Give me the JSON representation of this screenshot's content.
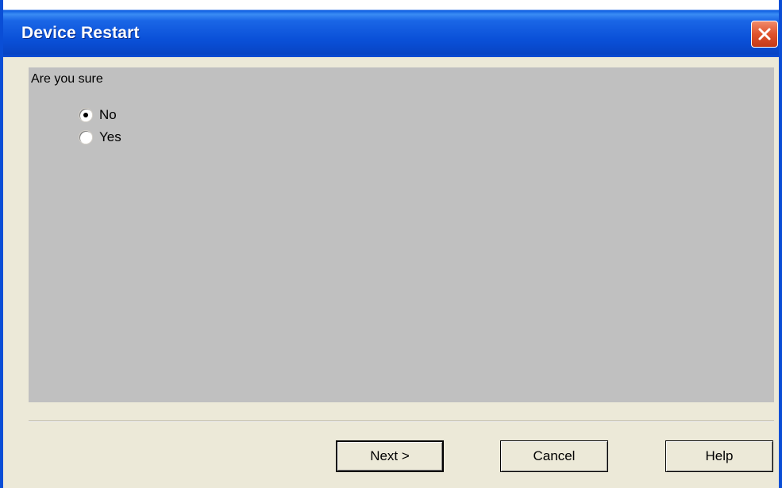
{
  "window": {
    "title": "Device Restart"
  },
  "content": {
    "question": "Are you sure",
    "options": [
      {
        "label": "No",
        "selected": true
      },
      {
        "label": "Yes",
        "selected": false
      }
    ]
  },
  "buttons": {
    "next": "Next >",
    "cancel": "Cancel",
    "help": "Help"
  },
  "icons": {
    "close": "close-icon"
  },
  "colors": {
    "titlebar": "#0a4ed6",
    "close_button": "#e0532c",
    "panel": "#c0c0c0",
    "window_bg": "#ece9d8"
  }
}
